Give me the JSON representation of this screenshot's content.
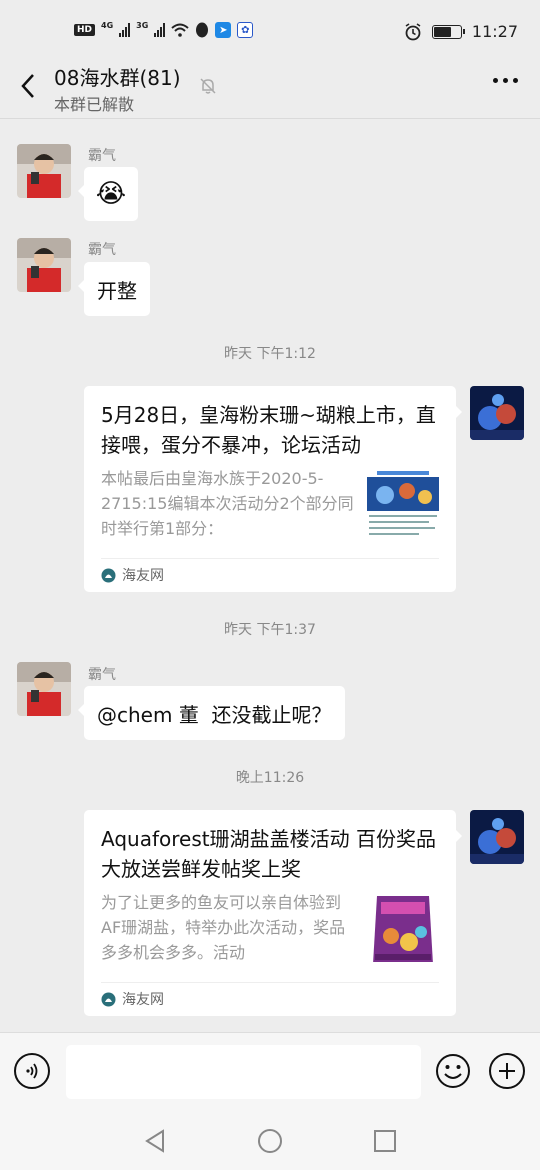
{
  "status_bar": {
    "hd": "HD",
    "net1": "4G",
    "net2": "3G",
    "time": "11:27",
    "battery_level": 0.6
  },
  "header": {
    "title": "08海水群(81)",
    "subtitle": "本群已解散"
  },
  "messages": {
    "m1_sender": "霸气",
    "m1_emoji": "😭",
    "m2_sender": "霸气",
    "m2_text": "开整",
    "time1": "昨天 下午1:12",
    "card1": {
      "title": "5月28日，皇海粉末珊~瑚粮上市，直接喂，蛋分不暴冲，论坛活动",
      "desc": "本帖最后由皇海水族于2020-5-2715:15编辑本次活动分2个部分同时举行第1部分：",
      "source": "海友网"
    },
    "time2": "昨天 下午1:37",
    "m3_sender": "霸气",
    "m3_text": "@chem 董  还没截止呢？",
    "time3": "晚上11:26",
    "card2": {
      "title": "Aquaforest珊湖盐盖楼活动 百份奖品大放送尝鲜发帖奖上奖",
      "desc": "为了让更多的鱼友可以亲自体验到AF珊湖盐，特举办此次活动，奖品多多机会多多。活动",
      "source": "海友网"
    }
  },
  "input": {
    "value": ""
  },
  "colors": {
    "background": "#ededed",
    "bubble": "#ffffff",
    "accent_red": "#d42a2a",
    "source_icon": "#2a6f7a"
  }
}
